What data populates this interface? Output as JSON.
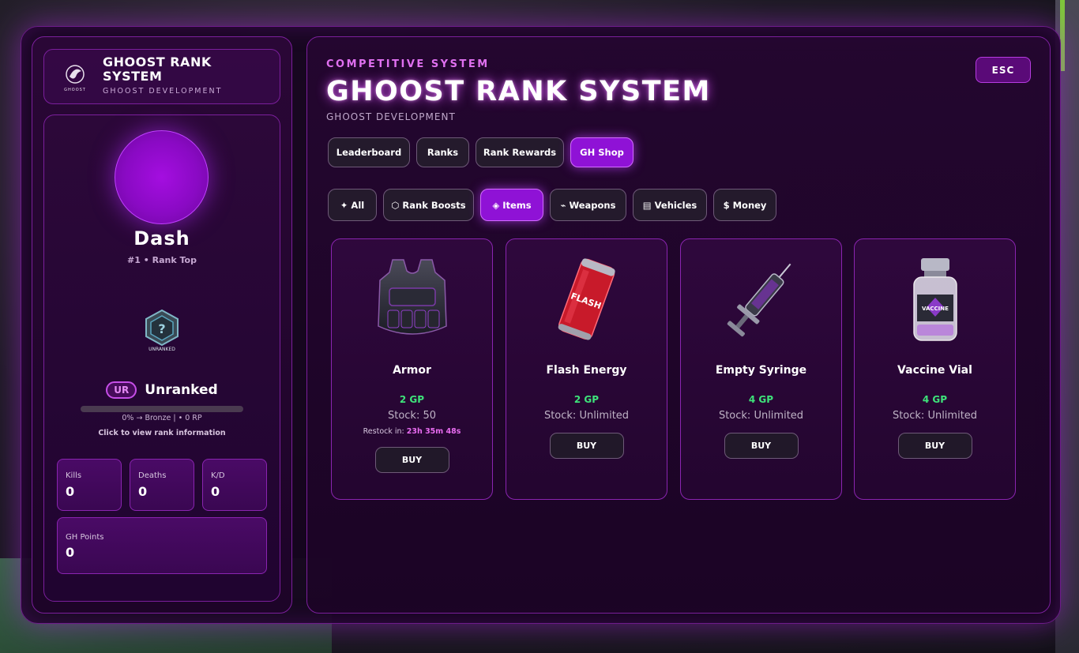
{
  "brand": {
    "logo_text": "GHOOST",
    "title": "GHOOST RANK SYSTEM",
    "subtitle": "GHOOST DEVELOPMENT"
  },
  "profile": {
    "name": "Dash",
    "rank_position": "#1 • Rank Top",
    "emblem_label": "UNRANKED",
    "rank_badge": "UR",
    "rank_name": "Unranked",
    "progress_fraction": 0,
    "progress_text": "0% → Bronze | • 0 RP",
    "rank_link": "Click to view rank information",
    "stats": {
      "kills_label": "Kills",
      "kills": "0",
      "deaths_label": "Deaths",
      "deaths": "0",
      "kd_label": "K/D",
      "kd": "0",
      "gh_label": "GH Points",
      "gh": "0"
    }
  },
  "header": {
    "kicker": "COMPETITIVE SYSTEM",
    "title": "GHOOST RANK SYSTEM",
    "subtitle": "GHOOST DEVELOPMENT",
    "esc": "ESC"
  },
  "tabs": [
    {
      "label": "Leaderboard",
      "active": false
    },
    {
      "label": "Ranks",
      "active": false
    },
    {
      "label": "Rank Rewards",
      "active": false
    },
    {
      "label": "GH Shop",
      "active": true
    }
  ],
  "filters": [
    {
      "icon": "✦",
      "label": "All",
      "active": false
    },
    {
      "icon": "⬡",
      "label": "Rank Boosts",
      "active": false
    },
    {
      "icon": "◈",
      "label": "Items",
      "active": true
    },
    {
      "icon": "⌁",
      "label": "Weapons",
      "active": false
    },
    {
      "icon": "▤",
      "label": "Vehicles",
      "active": false
    },
    {
      "icon": "$",
      "label": "Money",
      "active": false
    }
  ],
  "items": [
    {
      "name": "Armor",
      "price": "2 GP",
      "stock": "Stock: 50",
      "restock_label": "Restock in:",
      "restock_time": "23h 35m 48s",
      "buy": "BUY",
      "icon": "armor-vest"
    },
    {
      "name": "Flash Energy",
      "price": "2 GP",
      "stock": "Stock: Unlimited",
      "buy": "BUY",
      "icon": "energy-can",
      "can_text": "FLASH"
    },
    {
      "name": "Empty Syringe",
      "price": "4 GP",
      "stock": "Stock: Unlimited",
      "buy": "BUY",
      "icon": "syringe"
    },
    {
      "name": "Vaccine Vial",
      "price": "4 GP",
      "stock": "Stock: Unlimited",
      "buy": "BUY",
      "icon": "vial",
      "vial_text": "VACCINE"
    }
  ],
  "colors": {
    "accent": "#8f12d6",
    "price": "#3ee37a",
    "restock": "#e86cf0"
  }
}
